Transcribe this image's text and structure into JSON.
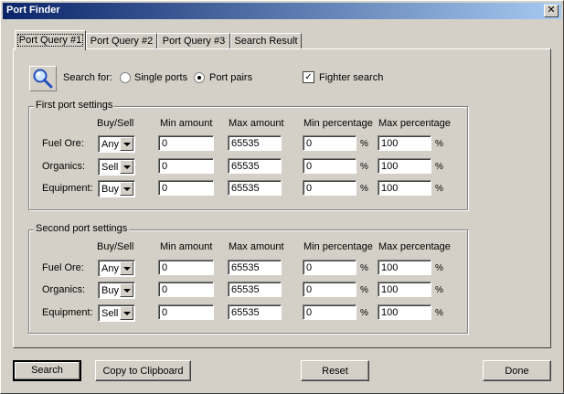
{
  "window": {
    "title": "Port Finder",
    "close_glyph": "✕"
  },
  "tabs": [
    {
      "label": "Port Query #1",
      "active": true
    },
    {
      "label": "Port Query #2",
      "active": false
    },
    {
      "label": "Port Query #3",
      "active": false
    },
    {
      "label": "Search Result",
      "active": false
    }
  ],
  "search": {
    "label": "Search for:",
    "options": [
      {
        "label": "Single ports",
        "checked": false
      },
      {
        "label": "Port pairs",
        "checked": true
      }
    ],
    "fighter_label": "Fighter search",
    "fighter_checked": true,
    "check_glyph": "✓"
  },
  "columns": {
    "buy_sell": "Buy/Sell",
    "min_amount": "Min amount",
    "max_amount": "Max amount",
    "min_pct": "Min percentage",
    "max_pct": "Max percentage",
    "pct_sign": "%"
  },
  "first": {
    "title": "First port settings",
    "rows": [
      {
        "label": "Fuel Ore:",
        "mode": "Any",
        "min_amount": "0",
        "max_amount": "65535",
        "min_pct": "0",
        "max_pct": "100"
      },
      {
        "label": "Organics:",
        "mode": "Sell",
        "min_amount": "0",
        "max_amount": "65535",
        "min_pct": "0",
        "max_pct": "100"
      },
      {
        "label": "Equipment:",
        "mode": "Buy",
        "min_amount": "0",
        "max_amount": "65535",
        "min_pct": "0",
        "max_pct": "100"
      }
    ]
  },
  "second": {
    "title": "Second port settings",
    "rows": [
      {
        "label": "Fuel Ore:",
        "mode": "Any",
        "min_amount": "0",
        "max_amount": "65535",
        "min_pct": "0",
        "max_pct": "100"
      },
      {
        "label": "Organics:",
        "mode": "Buy",
        "min_amount": "0",
        "max_amount": "65535",
        "min_pct": "0",
        "max_pct": "100"
      },
      {
        "label": "Equipment:",
        "mode": "Sell",
        "min_amount": "0",
        "max_amount": "65535",
        "min_pct": "0",
        "max_pct": "100"
      }
    ]
  },
  "buttons": {
    "search": "Search",
    "copy": "Copy to Clipboard",
    "reset": "Reset",
    "done": "Done"
  }
}
